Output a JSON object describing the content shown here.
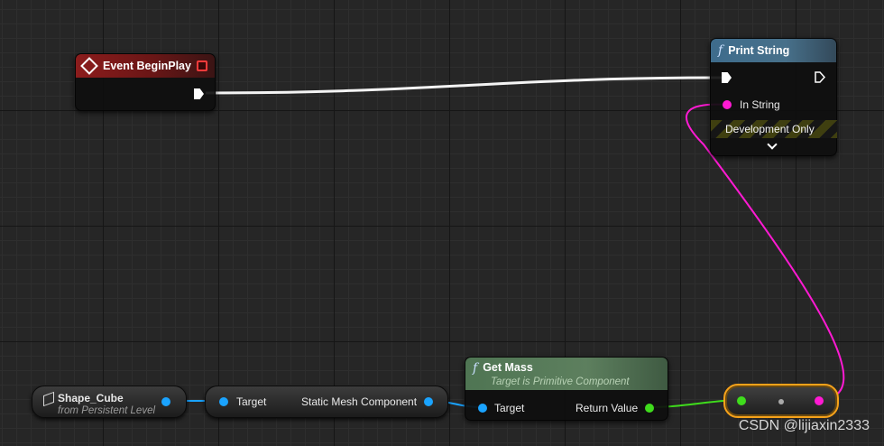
{
  "nodes": {
    "event_begin_play": {
      "title": "Event BeginPlay",
      "header_color": "#8c1c1c"
    },
    "print_string": {
      "icon_glyph": "f",
      "title": "Print String",
      "in_string_label": "In String",
      "dev_only_label": "Development Only",
      "expand_glyph": "⌄"
    },
    "get_mass": {
      "icon_glyph": "f",
      "title": "Get Mass",
      "subtitle": "Target is Primitive Component",
      "target_label": "Target",
      "return_label": "Return Value"
    },
    "shape_cube": {
      "title": "Shape_Cube",
      "subtitle": "from Persistent Level"
    },
    "static_mesh_getter": {
      "target_label": "Target",
      "output_label": "Static Mesh Component"
    }
  },
  "pin_colors": {
    "exec": "#ffffff",
    "object": "#1aa3ff",
    "float": "#3fdc1c",
    "string": "#ff1ad3",
    "reroute_border": "#f6a21a"
  },
  "watermark": "CSDN @lijiaxin2333"
}
